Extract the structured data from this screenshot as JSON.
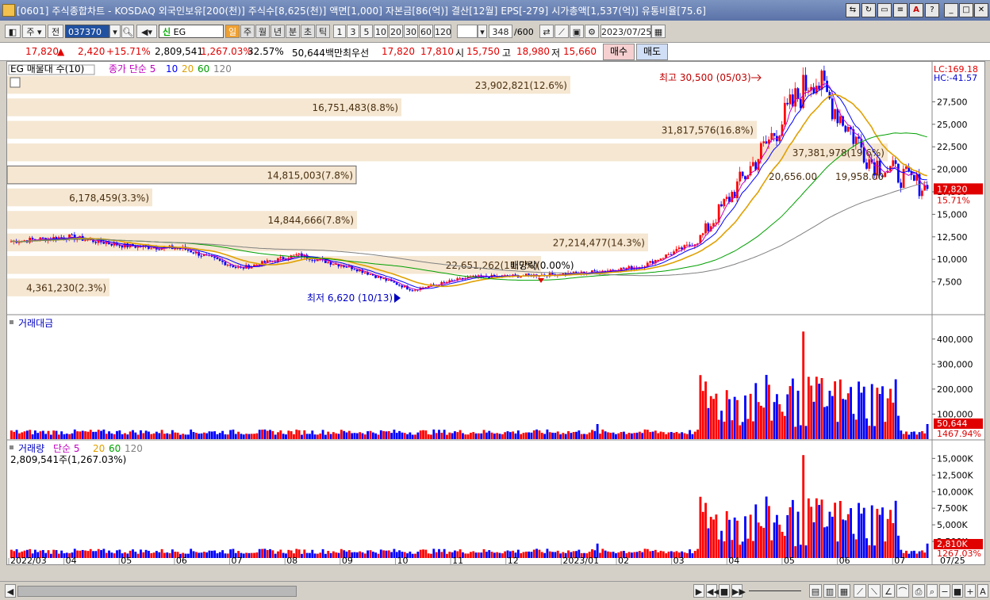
{
  "window": {
    "title": "[0601] 주식종합차트 - KOSDAQ 외국인보유[200(천)] 주식수[8,625(천)] 액면[1,000] 자본금[86(억)] 결산[12월] EPS[-279] 시가총액[1,537(억)] 유통비율[75.6]"
  },
  "toolbar": {
    "market_label": "주",
    "prev_label": "전",
    "code": "037370",
    "name": "EG",
    "period_buttons": [
      "일",
      "주",
      "월",
      "년",
      "분",
      "초",
      "틱"
    ],
    "interval_buttons": [
      "1",
      "3",
      "5",
      "10",
      "20",
      "30",
      "60",
      "120"
    ],
    "count_value": "348",
    "count_total": "/600",
    "date": "2023/07/25"
  },
  "quote": {
    "price": "17,820",
    "change_arrow": "▲",
    "change": "2,420",
    "change_pct": "+15.71%",
    "volume": "2,809,541",
    "volume_pct": "1,267.03%",
    "turnover_pct": "32.57%",
    "amount": "50,644백만",
    "best_label": "최우선",
    "best_ask": "17,820",
    "best_bid": "17,810",
    "open_label": "시",
    "open": "15,750",
    "high_label": "고",
    "high": "18,980",
    "low_label": "저",
    "low": "15,660",
    "buy_label": "매수",
    "sell_label": "매도"
  },
  "legends": {
    "price_title": "EG 매물대 수(10)",
    "price_ma": "종가 단순 5",
    "price_ma_periods": [
      "10",
      "20",
      "60",
      "120"
    ],
    "amount_title": "거래대금",
    "volume_title": "거래량",
    "volume_ma": "단순 5",
    "volume_ma_periods": [
      "20",
      "60",
      "120"
    ],
    "volume_info": "2,809,541주(1,267.03%)"
  },
  "price_labels": {
    "lc": "LC:169.18",
    "hc": "HC:-41.57",
    "current": "17,820",
    "current_pct": "15.71%",
    "high_mark": "최고 30,500 (05/03)",
    "low_mark": "최저 6,620 (10/13)",
    "dividend_mark": "배당락(0.00%)"
  },
  "amount_labels": {
    "current": "50,644",
    "pct": "1467.94%"
  },
  "volume_labels": {
    "current": "2,810K",
    "pct": "1267.03%"
  },
  "colors": {
    "up": "#ff0000",
    "down": "#0000ff",
    "ma5": "#c000c0",
    "ma10": "#0000ff",
    "ma20": "#e0a000",
    "ma60": "#00a000",
    "ma120": "#808080",
    "profile": "#f5e7d2"
  },
  "chart_data": [
    {
      "type": "candlestick",
      "title": "EG 매물대 수(10)",
      "x_labels": [
        "2022/03",
        "04",
        "05",
        "06",
        "07",
        "08",
        "09",
        "10",
        "11",
        "12",
        "2023/01",
        "02",
        "03",
        "04",
        "05",
        "06",
        "07"
      ],
      "last_label": "07/25",
      "y_ticks": [
        7500,
        10000,
        12500,
        15000,
        17500,
        20000,
        22500,
        25000,
        27500
      ],
      "ylim": [
        5000,
        30000
      ],
      "volume_profile": [
        {
          "label": "4,361,230(2.3%)",
          "value": 4361230
        },
        {
          "label": "22,651,262(11.7%)",
          "value": 22651262
        },
        {
          "label": "27,214,477(14.3%)",
          "value": 27214477
        },
        {
          "label": "14,844,666(7.8%)",
          "value": 14844666
        },
        {
          "label": "6,178,459(3.3%)",
          "value": 6178459
        },
        {
          "label": "14,815,003(7.8%)",
          "value": 14815003
        },
        {
          "label": "37,381,978(19.6%)",
          "value": 37381978
        },
        {
          "label": "31,817,576(16.8%)",
          "value": 31817576
        },
        {
          "label": "16,751,483(8.8%)",
          "value": 16751483
        },
        {
          "label": "23,902,821(12.6%)",
          "value": 23902821
        }
      ],
      "ma_labels": [
        "20,656.00",
        "19,958.00"
      ],
      "path_points": [
        [
          "2022/03",
          12000
        ],
        [
          "04",
          12500
        ],
        [
          "05",
          11500
        ],
        [
          "06",
          11200
        ],
        [
          "07",
          9000
        ],
        [
          "08",
          10500
        ],
        [
          "09",
          9000
        ],
        [
          "10",
          6620
        ],
        [
          "11",
          8000
        ],
        [
          "12",
          8200
        ],
        [
          "2023/01",
          8500
        ],
        [
          "02",
          9200
        ],
        [
          "03",
          12000
        ],
        [
          "04",
          21000
        ],
        [
          "05",
          30500
        ],
        [
          "06",
          21000
        ],
        [
          "07",
          17820
        ]
      ]
    },
    {
      "type": "bar",
      "title": "거래대금",
      "y_ticks": [
        100000,
        200000,
        300000,
        400000
      ],
      "ylim": [
        0,
        450000
      ]
    },
    {
      "type": "bar",
      "title": "거래량",
      "y_ticks": [
        "2,500K",
        "5,000K",
        "7,500K",
        "10,000K",
        "12,500K",
        "15,000K"
      ],
      "ylim": [
        0,
        16000
      ]
    }
  ]
}
